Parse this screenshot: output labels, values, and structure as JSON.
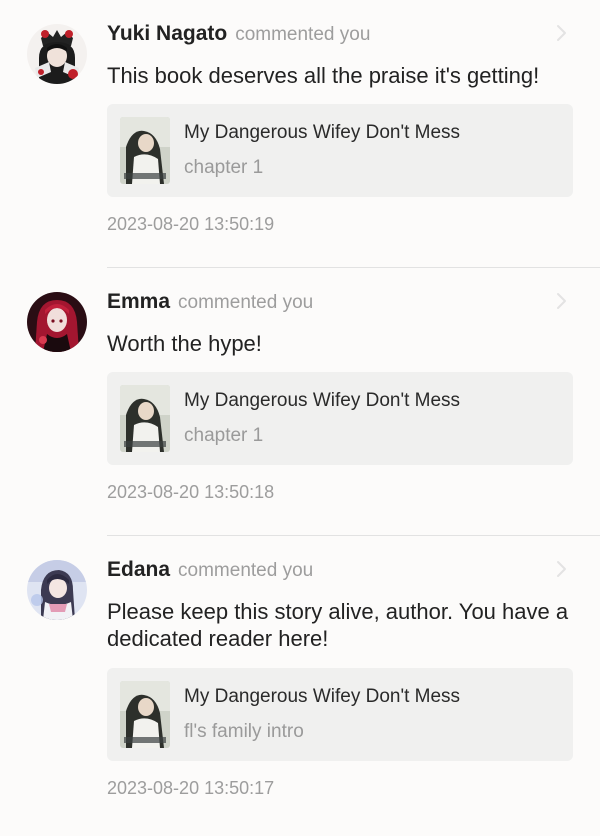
{
  "comments": [
    {
      "user": "Yuki Nagato",
      "action": "commented you",
      "text": "This book deserves all the praise it's getting!",
      "book_title": "My Dangerous Wifey Don't Mess",
      "chapter": "chapter 1",
      "timestamp": "2023-08-20 13:50:19",
      "avatar_icon": "dark-haired-character-avatar"
    },
    {
      "user": "Emma",
      "action": "commented you",
      "text": "Worth the hype!",
      "book_title": "My Dangerous Wifey Don't Mess",
      "chapter": "chapter 1",
      "timestamp": "2023-08-20 13:50:18",
      "avatar_icon": "red-haired-character-avatar"
    },
    {
      "user": "Edana",
      "action": "commented you",
      "text": "Please keep this story alive, author. You have a dedicated reader here!",
      "book_title": "My Dangerous Wifey Don't Mess",
      "chapter": "fl's family intro",
      "timestamp": "2023-08-20 13:50:17",
      "avatar_icon": "anime-girl-avatar"
    }
  ],
  "icons": {
    "chevron": "chevron-right-icon",
    "cover": "book-cover-thumbnail"
  },
  "colors": {
    "background": "#fcfbfa",
    "card": "#f0f0ef",
    "muted_text": "#9d9d9d",
    "primary_text": "#222222"
  }
}
